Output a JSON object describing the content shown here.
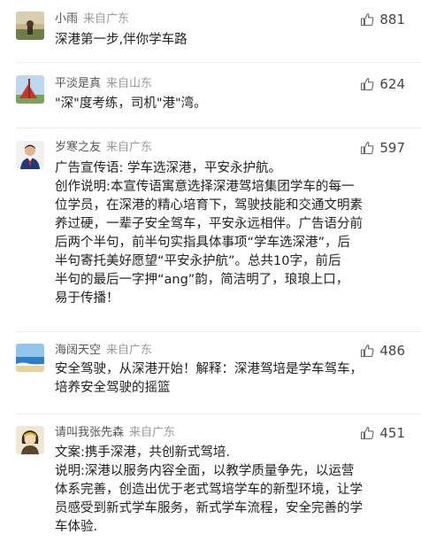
{
  "comments": [
    {
      "user": "小雨",
      "location": "来自广东",
      "likes": "881",
      "lines": [
        "深港第一步,伴你学车路"
      ]
    },
    {
      "user": "平淡是真",
      "location": "来自山东",
      "likes": "624",
      "lines": [
        "\"深\"度考练，司机\"港\"湾。"
      ]
    },
    {
      "user": "岁寒之友",
      "location": "来自广东",
      "likes": "597",
      "lines": [
        "广告宣传语: 学车选深港，平安永护航。",
        "创作说明:本宣传语寓意选择深港驾培集团学车的每一",
        "位学员，在深港的精心培育下，驾驶技能和交通文明素",
        "养过硬，一辈子安全驾车，平安永远相伴。广告语分前",
        "后两个半句，前半句实指具体事项“学车选深港”，后",
        "半句寄托美好愿望“平安永护航”。总共10字，前后",
        "半句的最后一字押“ang”韵，简洁明了，琅琅上口，",
        "易于传播！"
      ]
    },
    {
      "user": "海阔天空",
      "location": "来自广东",
      "likes": "486",
      "lines": [
        "安全驾驶，从深港开始！解释：深港驾培是学车驾车，",
        "培养安全驾驶的摇篮"
      ]
    },
    {
      "user": "请叫我张先森",
      "location": "来自广东",
      "likes": "451",
      "lines": [
        "文案:携手深港，共创新式驾培.",
        "说明:深港以服务内容全面，以教学质量争先，以运营",
        "体系完善，创造出优于老式驾培学车的新型环境，让学",
        "员感受到新式学车服务，新式学车流程，安全完善的学",
        "车体验."
      ]
    }
  ],
  "icons": {
    "like": "thumbs-up-icon"
  },
  "colors": {
    "meta": "#555555",
    "location": "#999999",
    "text": "#222222"
  }
}
